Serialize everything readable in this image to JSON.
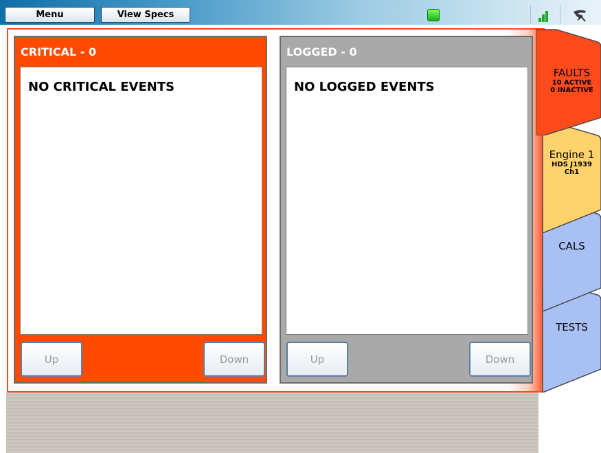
{
  "topbar": {
    "menu_label": "Menu",
    "view_specs_label": "View Specs"
  },
  "critical": {
    "title": "CRITICAL - 0",
    "empty_message": "NO CRITICAL EVENTS",
    "up_label": "Up",
    "down_label": "Down"
  },
  "logged": {
    "title": "LOGGED - 0",
    "empty_message": "NO LOGGED EVENTS",
    "up_label": "Up",
    "down_label": "Down"
  },
  "tabs": {
    "faults": {
      "label": "FAULTS",
      "line1": "10 ACTIVE",
      "line2": "0 INACTIVE"
    },
    "engine": {
      "label": "Engine 1",
      "line1": "HDS J1939",
      "line2": "Ch1"
    },
    "cals": {
      "label": "CALS"
    },
    "tests": {
      "label": "TESTS"
    }
  },
  "colors": {
    "critical": "#ff4a00",
    "logged": "#a9a9a9",
    "faults_tab": "#ff4a1c",
    "engine_tab": "#ffd36b",
    "blue_tab": "#a9c0f5"
  }
}
